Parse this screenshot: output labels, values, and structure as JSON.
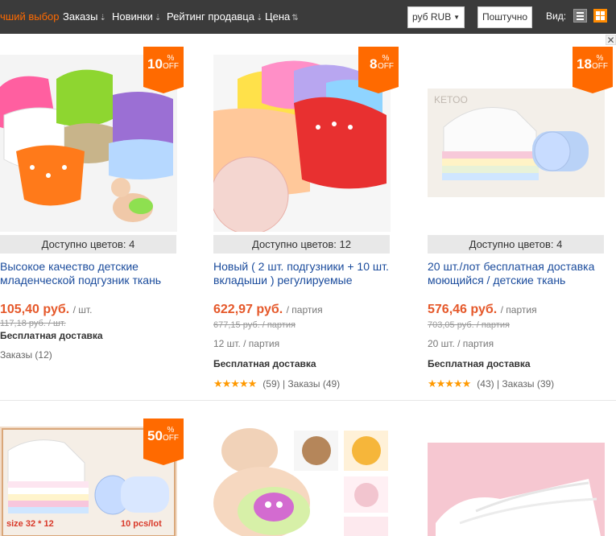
{
  "sortbar": {
    "items": [
      {
        "label": "чший выбор",
        "arrow": ""
      },
      {
        "label": "Заказы",
        "arrow": "⇣"
      },
      {
        "label": "Новинки",
        "arrow": "⇣"
      },
      {
        "label": "Рейтинг продавца",
        "arrow": "⇣"
      },
      {
        "label": "Цена",
        "arrow": "⇅"
      }
    ],
    "currency": "руб RUB",
    "unit_toggle": "Поштучно",
    "view_label": "Вид:"
  },
  "products": [
    {
      "discount": "10",
      "pct": "%",
      "off": "OFF",
      "colors": "Доступно цветов: 4",
      "title": "Высокое качество детские младенческой подгузник ткань",
      "price": "105,40 руб.",
      "price_unit": "/ шт.",
      "old_price": "117,18 руб. / шт.",
      "lot": "",
      "shipping": "Бесплатная доставка",
      "stars": "",
      "rating": "",
      "orders": "Заказы (12)"
    },
    {
      "discount": "8",
      "pct": "%",
      "off": "OFF",
      "colors": "Доступно цветов: 12",
      "title": "Новый ( 2 шт. подгузники + 10 шт. вкладыши ) регулируемые",
      "price": "622,97 руб.",
      "price_unit": "/ партия",
      "old_price": "677,15 руб. / партия",
      "lot": "12 шт. / партия",
      "shipping": "Бесплатная доставка",
      "stars": "★★★★★",
      "rating": "(59)  |  Заказы (49)",
      "orders": ""
    },
    {
      "discount": "18",
      "pct": "%",
      "off": "OFF",
      "colors": "Доступно цветов: 4",
      "title": "20 шт./лот бесплатная доставка моющийся / детские ткань",
      "price": "576,46 руб.",
      "price_unit": "/ партия",
      "old_price": "703,05 руб. / партия",
      "lot": "20 шт. / партия",
      "shipping": "Бесплатная доставка",
      "stars": "★★★★★",
      "rating": "(43)  |  Заказы (39)",
      "orders": ""
    },
    {
      "discount": "50",
      "pct": "%",
      "off": "OFF",
      "image_text": [
        "size 32 * 12",
        "10 pcs/lot"
      ]
    },
    {},
    {}
  ],
  "image_texts": {
    "ketoo": "KETOO"
  },
  "colors": {
    "topbar": "#3b3b3b",
    "accent": "#ff6a00",
    "link": "#1a4b9c",
    "price": "#e5582a"
  }
}
